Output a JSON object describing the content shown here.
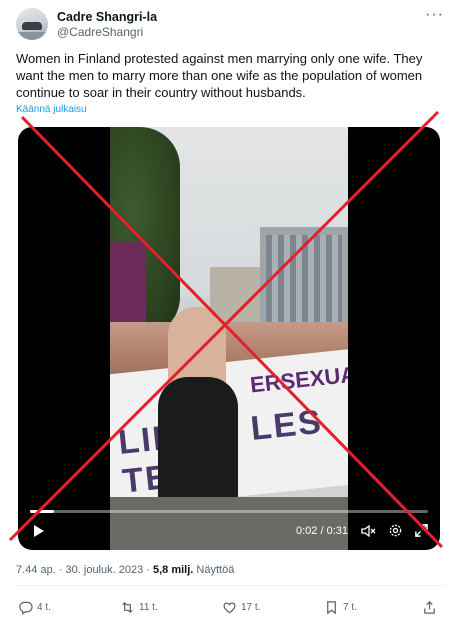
{
  "author": {
    "name": "Cadre Shangri-la",
    "handle": "@CadreShangri"
  },
  "tweet": {
    "text": "Women in Finland protested against men marrying only one wife. They want the men to marry more than one wife as the population of women continue to soar in their country without husbands.",
    "translate_label": "Käännä julkaisu"
  },
  "video": {
    "time": "0:02 / 0:31",
    "progress": 0.06,
    "banner_text": "LIB ES LES TE",
    "banner_top_text": "ERSEXUA"
  },
  "meta": {
    "timestamp": "7.44 ap. · 30. jouluk. 2023 · ",
    "views": "5,8 milj.",
    "views_label": " Näyttöä"
  },
  "actions": {
    "replies": "4 t.",
    "retweets": "11 t.",
    "likes": "17 t.",
    "bookmarks": "7 t."
  },
  "colors": {
    "accent": "#1d9bf0",
    "cross": "#e3202b",
    "muted": "#536471"
  }
}
